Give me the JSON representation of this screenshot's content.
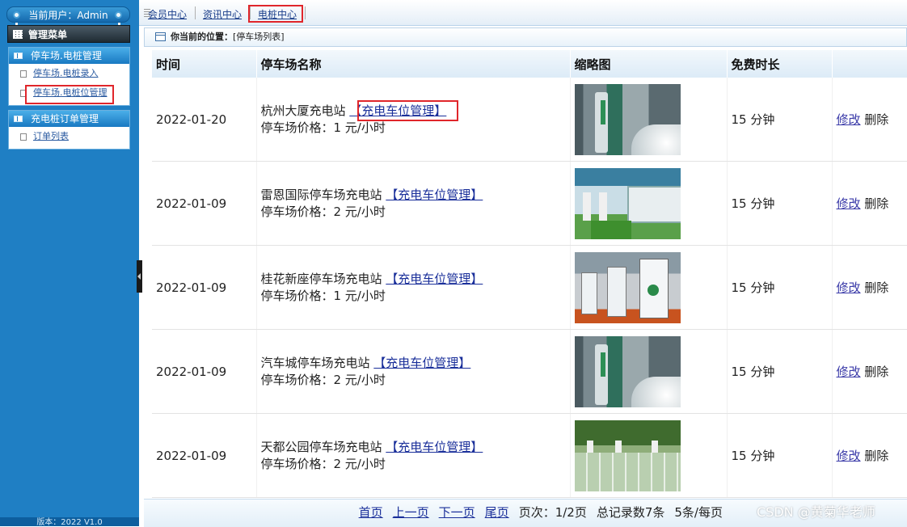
{
  "sidebar": {
    "current_user": "当前用户：Admin",
    "menu_title": "管理菜单",
    "groups": [
      {
        "title": "停车场.电桩管理",
        "items": [
          {
            "label": "停车场.电桩录入"
          },
          {
            "label": "停车场.电桩位管理"
          }
        ]
      },
      {
        "title": "充电桩订单管理",
        "items": [
          {
            "label": "订单列表"
          }
        ]
      }
    ],
    "version": "版本：2022 V1.0"
  },
  "topnav": {
    "links": [
      {
        "label": "会员中心"
      },
      {
        "label": "资讯中心"
      },
      {
        "label": "电桩中心"
      }
    ]
  },
  "breadcrumb": {
    "prefix": "你当前的位置：",
    "current": "[停车场列表]"
  },
  "table": {
    "headers": [
      "时间",
      "停车场名称",
      "缩略图",
      "免费时长",
      ""
    ],
    "manage_label": "【充电车位管理】",
    "edit_label": "修改",
    "delete_label": "删除",
    "rows": [
      {
        "time": "2022-01-20",
        "name": "杭州大厦充电站",
        "price": "停车场价格：1 元/小时",
        "free": "15 分钟",
        "thumb_icon": "charging-station-photo"
      },
      {
        "time": "2022-01-09",
        "name": "雷恩国际停车场充电站",
        "price": "停车场价格：2 元/小时",
        "free": "15 分钟",
        "thumb_icon": "charging-bus-photo"
      },
      {
        "time": "2022-01-09",
        "name": "桂花新座停车场充电站",
        "price": "停车场价格：1 元/小时",
        "free": "15 分钟",
        "thumb_icon": "charging-piles-photo"
      },
      {
        "time": "2022-01-09",
        "name": "汽车城停车场充电站",
        "price": "停车场价格：2 元/小时",
        "free": "15 分钟",
        "thumb_icon": "charging-station-photo"
      },
      {
        "time": "2022-01-09",
        "name": "天都公园停车场充电站",
        "price": "停车场价格：2 元/小时",
        "free": "15 分钟",
        "thumb_icon": "green-parking-lot-photo"
      }
    ]
  },
  "pager": {
    "first": "首页",
    "prev": "上一页",
    "next": "下一页",
    "last": "尾页",
    "page_info": "页次：1/2页",
    "total": "总记录数7条",
    "per_page": "5条/每页"
  },
  "watermark": "CSDN @黄菊华老师",
  "colors": {
    "sidebar_bg": "#1f7fc4",
    "highlight_box": "#e0262b",
    "link": "#1a2f9a"
  }
}
